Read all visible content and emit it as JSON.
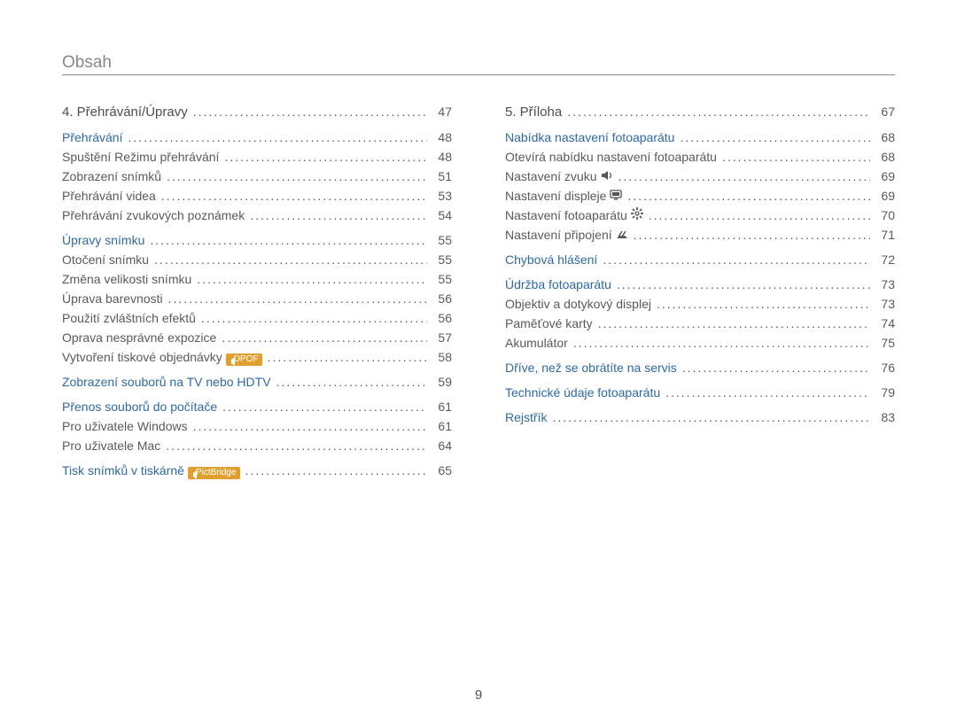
{
  "title": "Obsah",
  "page_number": "9",
  "left": {
    "section": {
      "label": "4. Přehrávání/Úpravy",
      "page": "47"
    },
    "groups": [
      {
        "header": {
          "label": "Přehrávání",
          "page": "48",
          "link": true
        },
        "items": [
          {
            "label": "Spuštění Režimu přehrávání",
            "page": "48"
          },
          {
            "label": "Zobrazení snímků",
            "page": "51"
          },
          {
            "label": "Přehrávání videa",
            "page": "53"
          },
          {
            "label": "Přehrávání zvukových poznámek",
            "page": "54"
          }
        ]
      },
      {
        "header": {
          "label": "Úpravy snímku",
          "page": "55",
          "link": true
        },
        "items": [
          {
            "label": "Otočení snímku",
            "page": "55"
          },
          {
            "label": "Změna velikosti snímku",
            "page": "55"
          },
          {
            "label": "Úprava barevnosti",
            "page": "56"
          },
          {
            "label": "Použití zvláštních efektů",
            "page": "56"
          },
          {
            "label": "Oprava nesprávné expozice",
            "page": "57"
          },
          {
            "label": "Vytvoření tiskové objednávky",
            "page": "58",
            "badge": "DPOF"
          }
        ]
      },
      {
        "header": {
          "label": "Zobrazení souborů na TV nebo HDTV",
          "page": "59",
          "link": true
        },
        "items": []
      },
      {
        "header": {
          "label": "Přenos souborů do počítače",
          "page": "61",
          "link": true
        },
        "items": [
          {
            "label": "Pro uživatele Windows",
            "page": "61"
          },
          {
            "label": "Pro uživatele Mac",
            "page": "64"
          }
        ]
      },
      {
        "header": {
          "label": "Tisk snímků v tiskárně",
          "page": "65",
          "link": true,
          "badge": "PictBridge"
        },
        "items": []
      }
    ]
  },
  "right": {
    "section": {
      "label": "5. Příloha",
      "page": "67"
    },
    "groups": [
      {
        "header": {
          "label": "Nabídka nastavení fotoaparátu",
          "page": "68",
          "link": true
        },
        "items": [
          {
            "label": "Otevírá nabídku nastavení fotoaparátu",
            "page": "68"
          },
          {
            "label": "Nastavení zvuku",
            "page": "69",
            "icon": "sound"
          },
          {
            "label": "Nastavení displeje",
            "page": "69",
            "icon": "display"
          },
          {
            "label": "Nastavení fotoaparátu",
            "page": "70",
            "icon": "gear"
          },
          {
            "label": "Nastavení připojení",
            "page": "71",
            "icon": "connect"
          }
        ]
      },
      {
        "header": {
          "label": "Chybová hlášení",
          "page": "72",
          "link": true
        },
        "items": []
      },
      {
        "header": {
          "label": "Údržba fotoaparátu",
          "page": "73",
          "link": true
        },
        "items": [
          {
            "label": "Objektiv a dotykový displej",
            "page": "73"
          },
          {
            "label": "Paměťové karty",
            "page": "74"
          },
          {
            "label": "Akumulátor",
            "page": "75"
          }
        ]
      },
      {
        "header": {
          "label": "Dříve, než se obrátíte na servis",
          "page": "76",
          "link": true
        },
        "items": []
      },
      {
        "header": {
          "label": "Technické údaje fotoaparátu",
          "page": "79",
          "link": true
        },
        "items": []
      },
      {
        "header": {
          "label": "Rejstřík",
          "page": "83",
          "link": true
        },
        "items": []
      }
    ]
  }
}
